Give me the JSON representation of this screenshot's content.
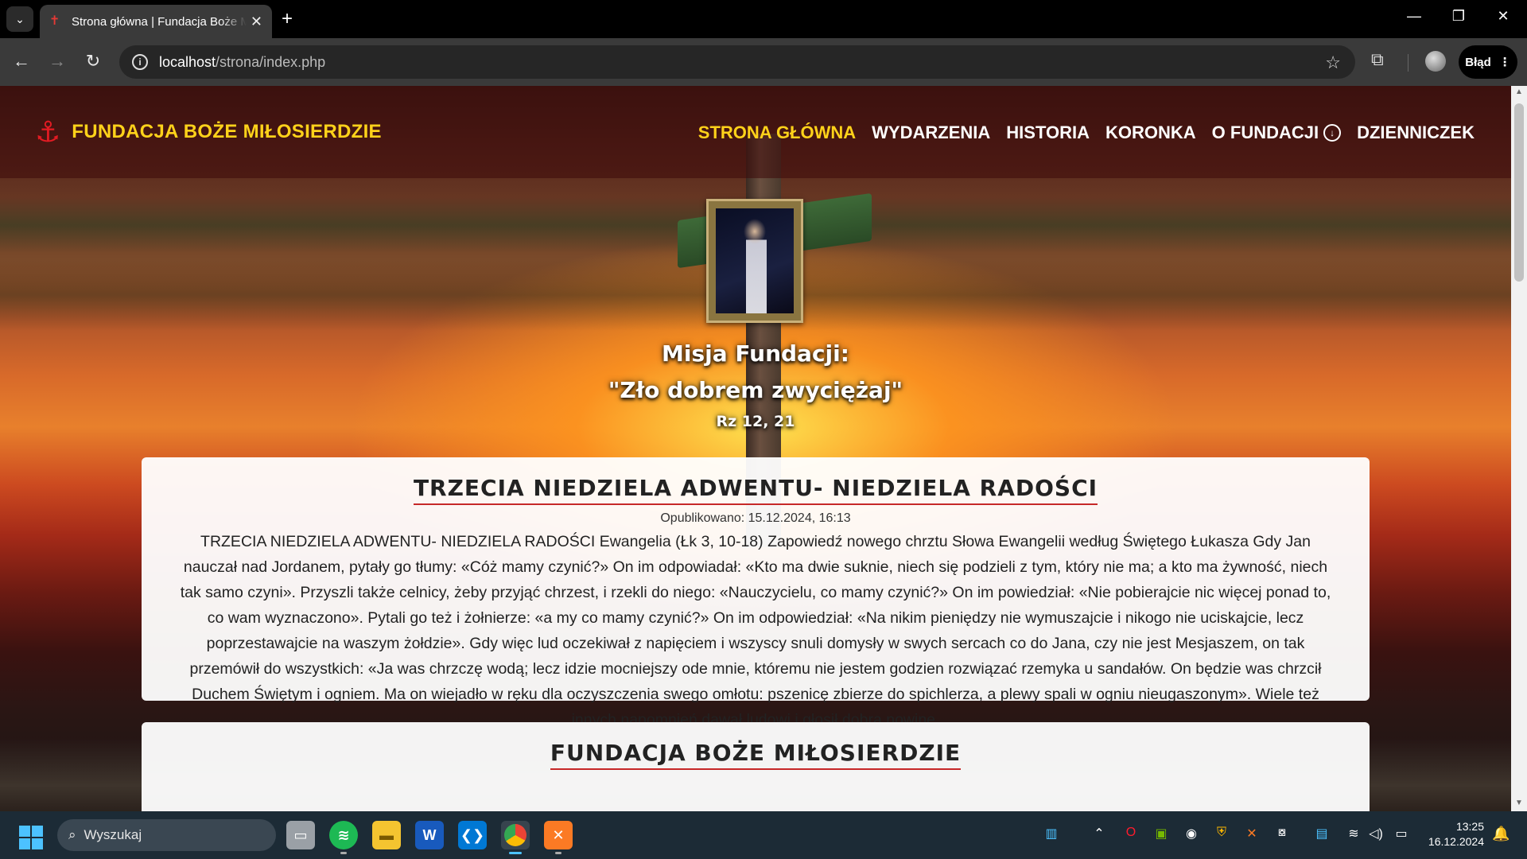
{
  "browser": {
    "tab_title": "Strona główna | Fundacja Boże Miłosierdzie",
    "url_host": "localhost",
    "url_path": "/strona/index.php",
    "error_button": "Błąd"
  },
  "site": {
    "brand": "FUNDACJA BOŻE MIŁOSIERDZIE",
    "nav": [
      {
        "label": "STRONA GŁÓWNA",
        "active": true
      },
      {
        "label": "WYDARZENIA"
      },
      {
        "label": "HISTORIA"
      },
      {
        "label": "KORONKA"
      },
      {
        "label": "O FUNDACJI"
      },
      {
        "label": "DZIENNICZEK"
      }
    ],
    "mission": {
      "line1": "Misja Fundacji:",
      "line2": "\"Zło dobrem zwyciężaj\"",
      "ref": "Rz 12, 21"
    }
  },
  "posts": [
    {
      "title": "TRZECIA NIEDZIELA ADWENTU- NIEDZIELA RADOŚCI",
      "date": "Opublikowano: 15.12.2024, 16:13",
      "body": "TRZECIA NIEDZIELA ADWENTU- NIEDZIELA RADOŚCI Ewangelia (Łk 3, 10-18) Zapowiedź nowego chrztu Słowa Ewangelii według Świętego Łukasza Gdy Jan nauczał nad Jordanem, pytały go tłumy: «Cóż mamy czynić?» On im odpowiadał: «Kto ma dwie suknie, niech się podzieli z tym, który nie ma; a kto ma żywność, niech tak samo czyni». Przyszli także celnicy, żeby przyjąć chrzest, i rzekli do niego: «Nauczycielu, co mamy czynić?» On im powiedział: «Nie pobierajcie nic więcej ponad to, co wam wyznaczono». Pytali go też i żołnierze: «a my co mamy czynić?» On im odpowiedział: «Na nikim pieniędzy nie wymuszajcie i nikogo nie uciskajcie, lecz poprzestawajcie na waszym żołdzie». Gdy więc lud oczekiwał z napięciem i wszyscy snuli domysły w swych sercach co do Jana, czy nie jest Mesjaszem, on tak przemówił do wszystkich: «Ja was chrzczę wodą; lecz idzie mocniejszy ode mnie, któremu nie jestem godzien rozwiązać rzemyka u sandałów. On będzie was chrzcił Duchem Świętym i ogniem. Ma on wiejadło w ręku dla oczyszczenia swego omłotu: pszenicę zbierze do spichlerza, a plewy spali w ogniu nieugaszonym». Wiele też innych napomnień dawał ludowi i głosił dobrą nowinę."
    },
    {
      "title": "FUNDACJA BOŻE MIŁOSIERDZIE"
    }
  ],
  "taskbar": {
    "search_placeholder": "Wyszukaj",
    "time": "13:25",
    "date": "16.12.2024"
  },
  "colors": {
    "brand_yellow": "#ffd21a",
    "brand_red": "#e31b23",
    "title_underline": "#c62828"
  }
}
